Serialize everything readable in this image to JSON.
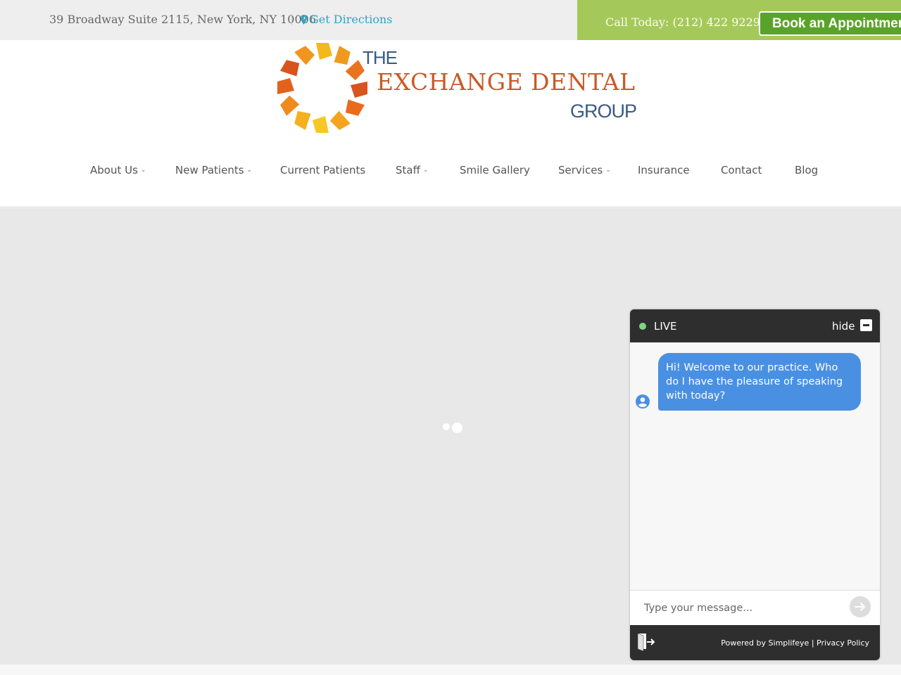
{
  "topbar": {
    "address": "39 Broadway Suite 2115, New York, NY 10006",
    "directions_label": "Get Directions",
    "call_label": "Call Today:",
    "phone": "(212) 422 9229",
    "book_label": "Book an Appointment"
  },
  "logo": {
    "line1": "THE",
    "line2": "EXCHANGE DENTAL",
    "line3": "GROUP"
  },
  "nav": {
    "items": [
      {
        "label": "About Us",
        "dropdown": true
      },
      {
        "label": "New Patients",
        "dropdown": true
      },
      {
        "label": "Current Patients",
        "dropdown": false
      },
      {
        "label": "Staff",
        "dropdown": true
      },
      {
        "label": "Smile Gallery",
        "dropdown": false
      },
      {
        "label": "Services",
        "dropdown": true
      },
      {
        "label": "Insurance",
        "dropdown": false
      },
      {
        "label": "Contact",
        "dropdown": false
      },
      {
        "label": "Blog",
        "dropdown": false
      }
    ]
  },
  "chat": {
    "status": "LIVE",
    "hide_label": "hide",
    "message": "Hi! Welcome to our practice.  Who do I have the pleasure of speaking with today?",
    "input_placeholder": "Type your message...",
    "powered_prefix": "Powered by",
    "powered_brand": "Simplifeye",
    "divider": "|",
    "privacy_label": "Privacy Policy"
  },
  "colors": {
    "accent_green": "#a4c95a",
    "button_green": "#5aa32a",
    "link_blue": "#2aa6c7",
    "chat_bubble": "#4a90e2",
    "logo_orange": "#c95a26",
    "logo_blue": "#3a5a85"
  }
}
